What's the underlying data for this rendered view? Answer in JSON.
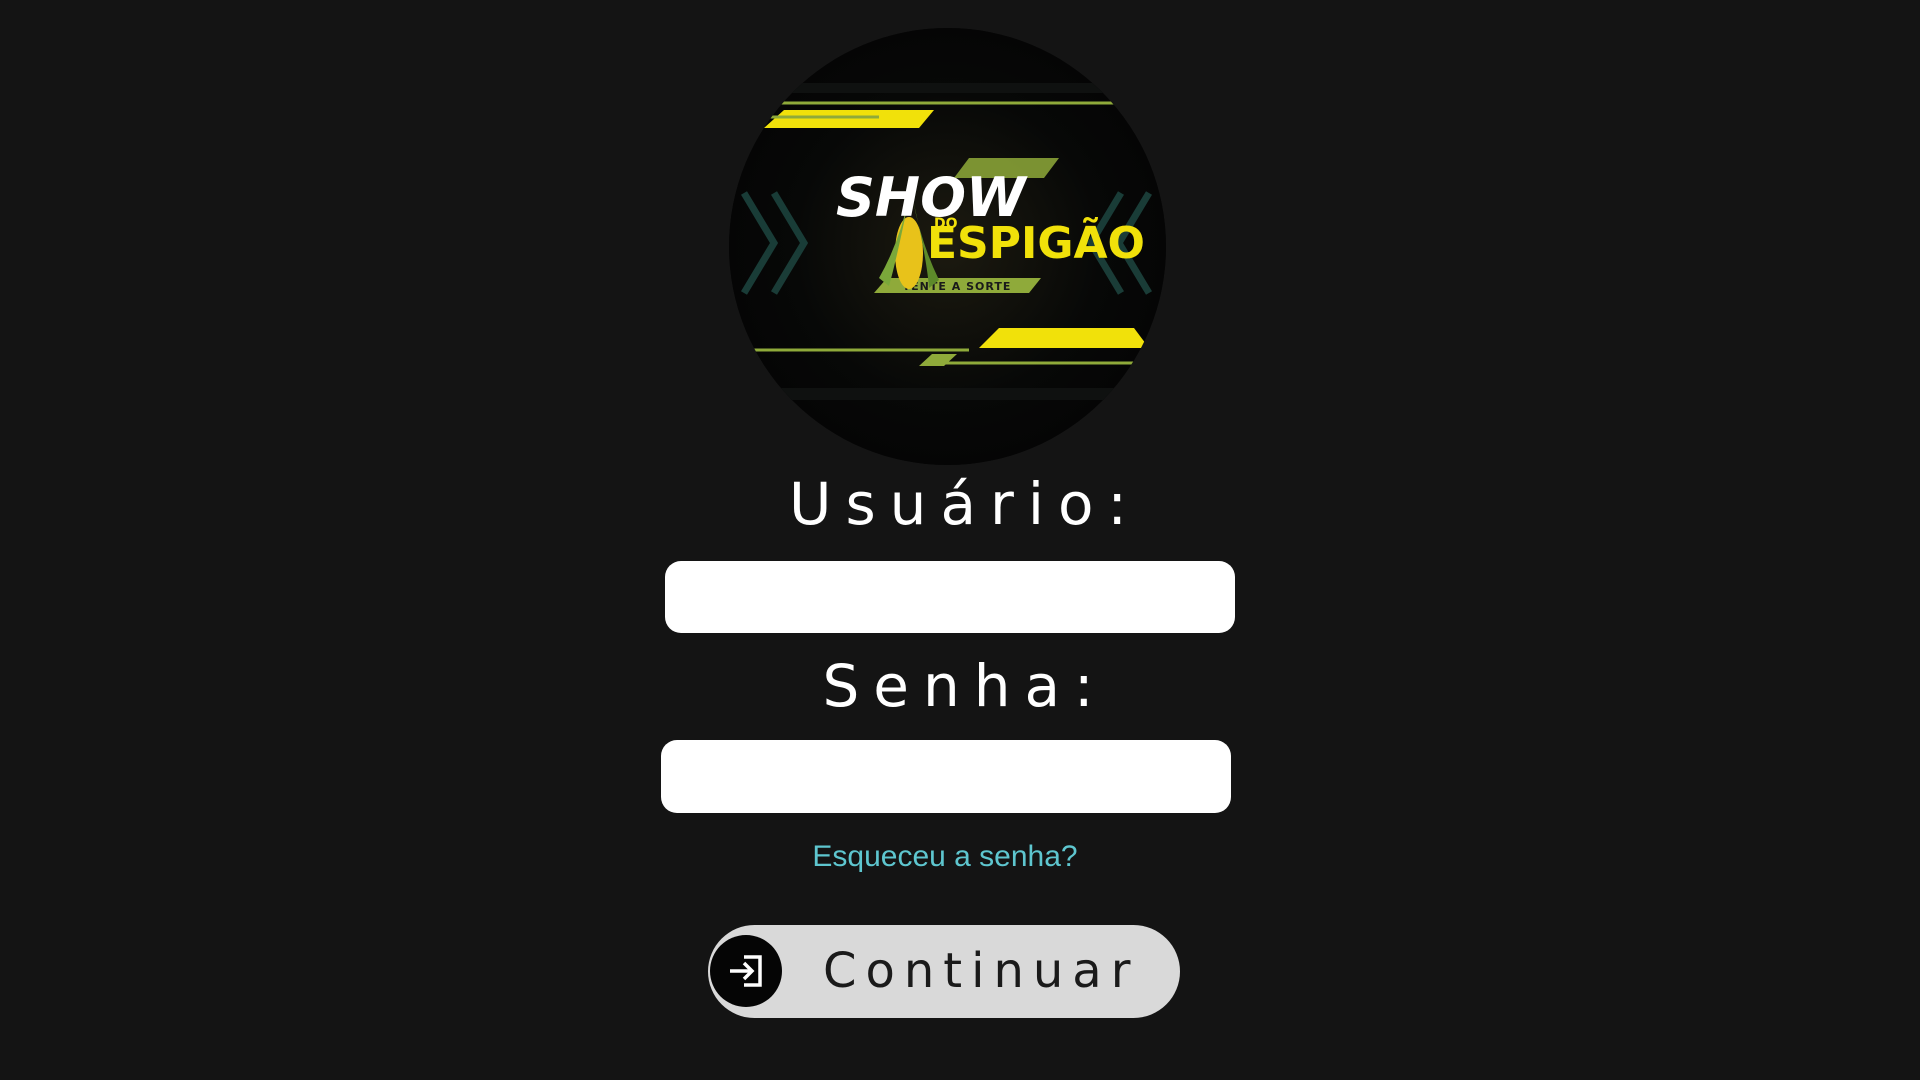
{
  "logo": {
    "title_line1": "SHOW",
    "title_small": "DO",
    "title_line2": "ESPIGÃO",
    "tagline": "TENTE A SORTE"
  },
  "form": {
    "username_label": "Usuário:",
    "username_value": "",
    "password_label": "Senha:",
    "password_value": "",
    "forgot_password": "Esqueceu a senha?",
    "continue_label": "Continuar"
  },
  "icons": {
    "continue_icon": "login-arrow-icon"
  },
  "colors": {
    "background": "#141414",
    "link": "#5ec6cf",
    "button": "#d9d9d9",
    "logo_yellow": "#f1e10a",
    "logo_green": "#8faa3a"
  }
}
